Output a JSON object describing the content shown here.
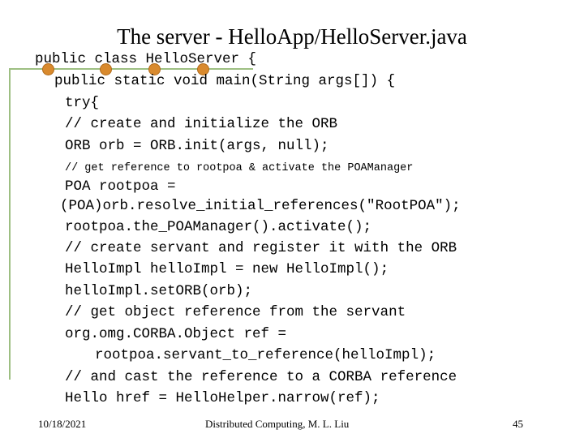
{
  "slide": {
    "title": "The server - HelloApp/HelloServer.java",
    "code_lines": [
      "public class HelloServer {",
      "public static void main(String args[]) {",
      "try{",
      "// create and initialize the ORB",
      "ORB orb = ORB.init(args, null);",
      "// get reference to rootpoa & activate the POAManager",
      "POA rootpoa =",
      "(POA)orb.resolve_initial_references(\"RootPOA\");",
      "rootpoa.the_POAManager().activate();",
      "// create servant and register it with the ORB",
      "HelloImpl helloImpl = new HelloImpl();",
      "helloImpl.setORB(orb);",
      "// get object reference from the servant",
      "org.omg.CORBA.Object ref =",
      "rootpoa.servant_to_reference(helloImpl);",
      "// and cast the reference to a CORBA reference",
      "Hello href = HelloHelper.narrow(ref);"
    ],
    "footer": {
      "date": "10/18/2021",
      "course": "Distributed Computing, M. L. Liu",
      "page_number": "45"
    }
  },
  "colors": {
    "accent_line": "#9dbf82",
    "bullet_dot": "#d98a2e"
  }
}
